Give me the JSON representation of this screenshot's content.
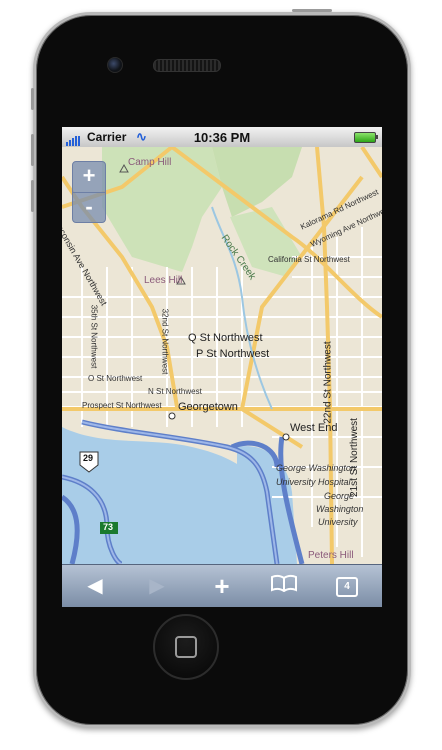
{
  "status": {
    "carrier": "Carrier",
    "time": "10:36 PM",
    "wifi_icon": "wifi-icon",
    "battery_icon": "battery-icon"
  },
  "map": {
    "zoom_in": "+",
    "zoom_out": "-",
    "labels": [
      "Camp Hill",
      "Wisconsin Ave Northwest",
      "Rock Creek",
      "Kalorama Rd Northwest",
      "Wyoming Ave Northwest",
      "California St Northwest",
      "Lees Hill",
      "32nd St Northwest",
      "35th St Northwest",
      "Q St Northwest",
      "P St Northwest",
      "O St Northwest",
      "N St Northwest",
      "Prospect St Northwest",
      "Georgetown",
      "West End",
      "22nd St Northwest",
      "21st St Northwest",
      "George Washington",
      "University Hospital",
      "George",
      "Washington",
      "University",
      "Peters Hill",
      "29",
      "73"
    ]
  },
  "toolbar": {
    "back_icon": "back-arrow-icon",
    "forward_icon": "forward-arrow-icon",
    "add_icon": "add-bookmark-icon",
    "bookmarks_icon": "bookmarks-icon",
    "tabs_count": "4"
  }
}
